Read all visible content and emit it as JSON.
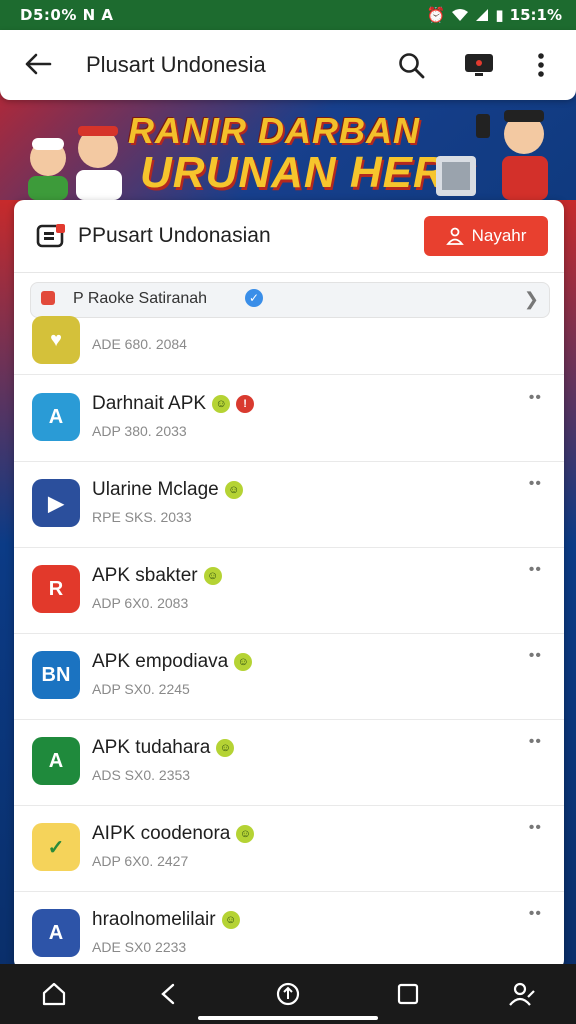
{
  "status": {
    "time": "D5:0%",
    "carrier": "N A",
    "battery": "15:1%"
  },
  "appbar": {
    "title": "Plusart Undonesia"
  },
  "banner": {
    "line1": "RANIR DARBAN",
    "line2": "URUNAN HERS"
  },
  "header": {
    "name": "PPusart Undonasian",
    "button_label": "Nayahr"
  },
  "subbar": {
    "label": "Raoke Satiranah",
    "prefix": "P"
  },
  "partial_row": {
    "meta": "ADE 680. 2084"
  },
  "apps": [
    {
      "name": "Darhnait APK",
      "meta": "ADP 380. 2033",
      "icon_text": "A",
      "icon_bg": "#2a9bd6"
    },
    {
      "name": "Ularine Mclage",
      "meta": "RPE SKS. 2033",
      "icon_text": "▶",
      "icon_bg": "#2b4f9c"
    },
    {
      "name": "APK sbakter",
      "meta": "ADP 6X0. 2083",
      "icon_text": "R",
      "icon_bg": "#e2392b"
    },
    {
      "name": "APK empodiava",
      "meta": "ADP SX0. 2245",
      "icon_text": "BN",
      "icon_bg": "#1b73c1"
    },
    {
      "name": "APK tudahara",
      "meta": "ADS SX0. 2353",
      "icon_text": "A",
      "icon_bg": "#1f8a3c"
    },
    {
      "name": "AIPK coodenora",
      "meta": "ADP 6X0. 2427",
      "icon_text": "✓",
      "icon_bg": "#f5d35a"
    },
    {
      "name": "hraolnomelilair",
      "meta": "ADE SX0 2233",
      "icon_text": "A",
      "icon_bg": "#2d54a8"
    }
  ],
  "more_label": "••",
  "colors": {
    "accent": "#e8402f",
    "badge": "#b5d334"
  }
}
